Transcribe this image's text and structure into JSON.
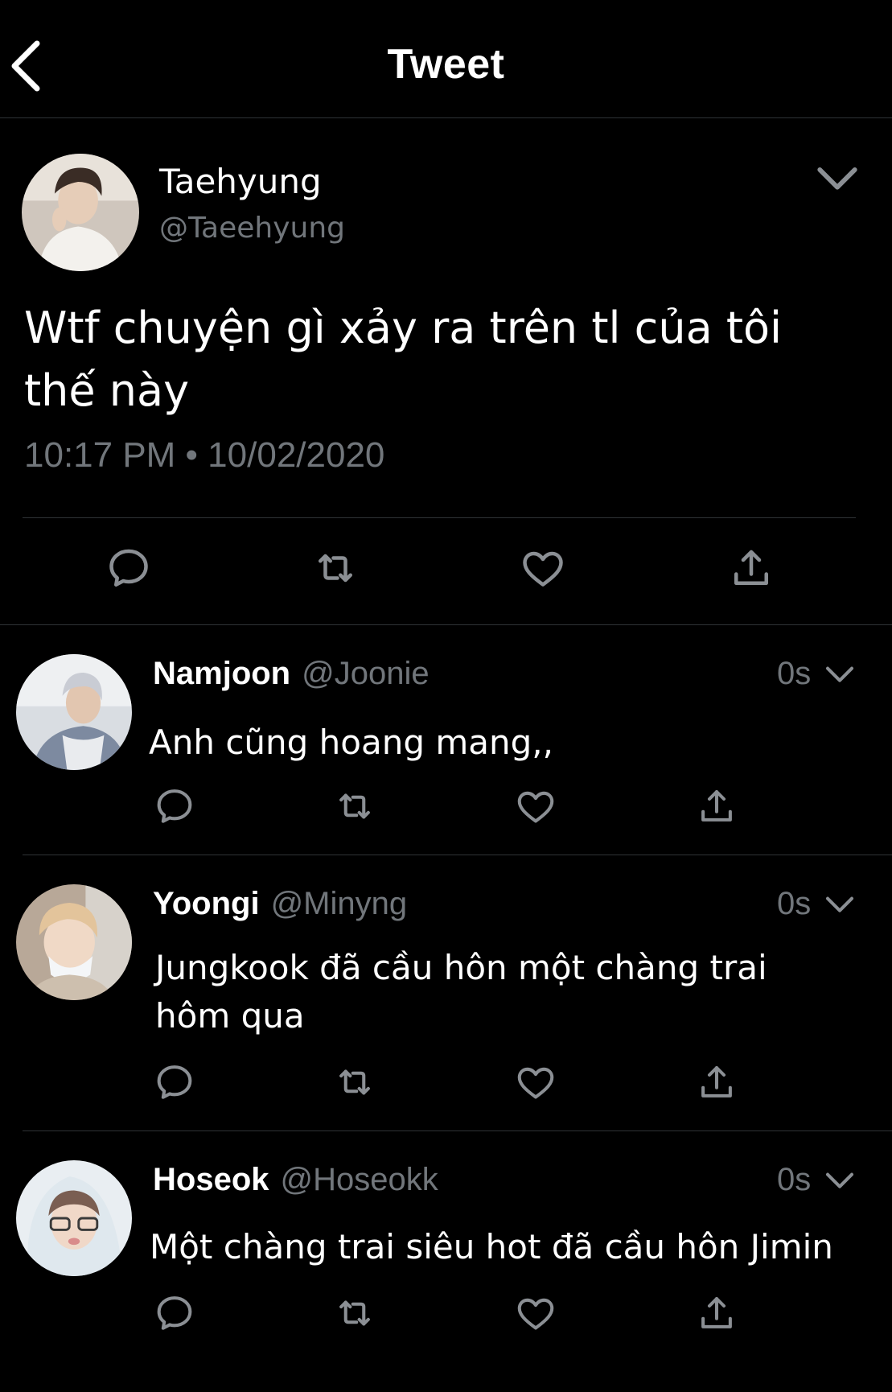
{
  "header": {
    "title": "Tweet",
    "back_icon": "chevron-left-icon"
  },
  "main_tweet": {
    "name": "Taehyung",
    "handle": "@Taeehyung",
    "text": "Wtf chuyện gì xảy ra trên tl của tôi thế này",
    "timestamp": "10:17 PM • 10/02/2020"
  },
  "replies": [
    {
      "name": "Namjoon",
      "handle": "@Joonie",
      "time": "0s",
      "text": "Anh cũng hoang mang,,"
    },
    {
      "name": "Yoongi",
      "handle": "@Minyng",
      "time": "0s",
      "text": "Jungkook đã cầu hôn một chàng trai hôm qua"
    },
    {
      "name": "Hoseok",
      "handle": "@Hoseokk",
      "time": "0s",
      "text": "Một chàng trai siêu hot đã cầu hôn Jimin"
    }
  ],
  "icons": [
    "reply-icon",
    "retweet-icon",
    "like-icon",
    "share-icon",
    "chevron-down-icon"
  ],
  "colors": {
    "background": "#000000",
    "text": "#ffffff",
    "secondary": "#71767b",
    "divider": "#2f3336"
  }
}
